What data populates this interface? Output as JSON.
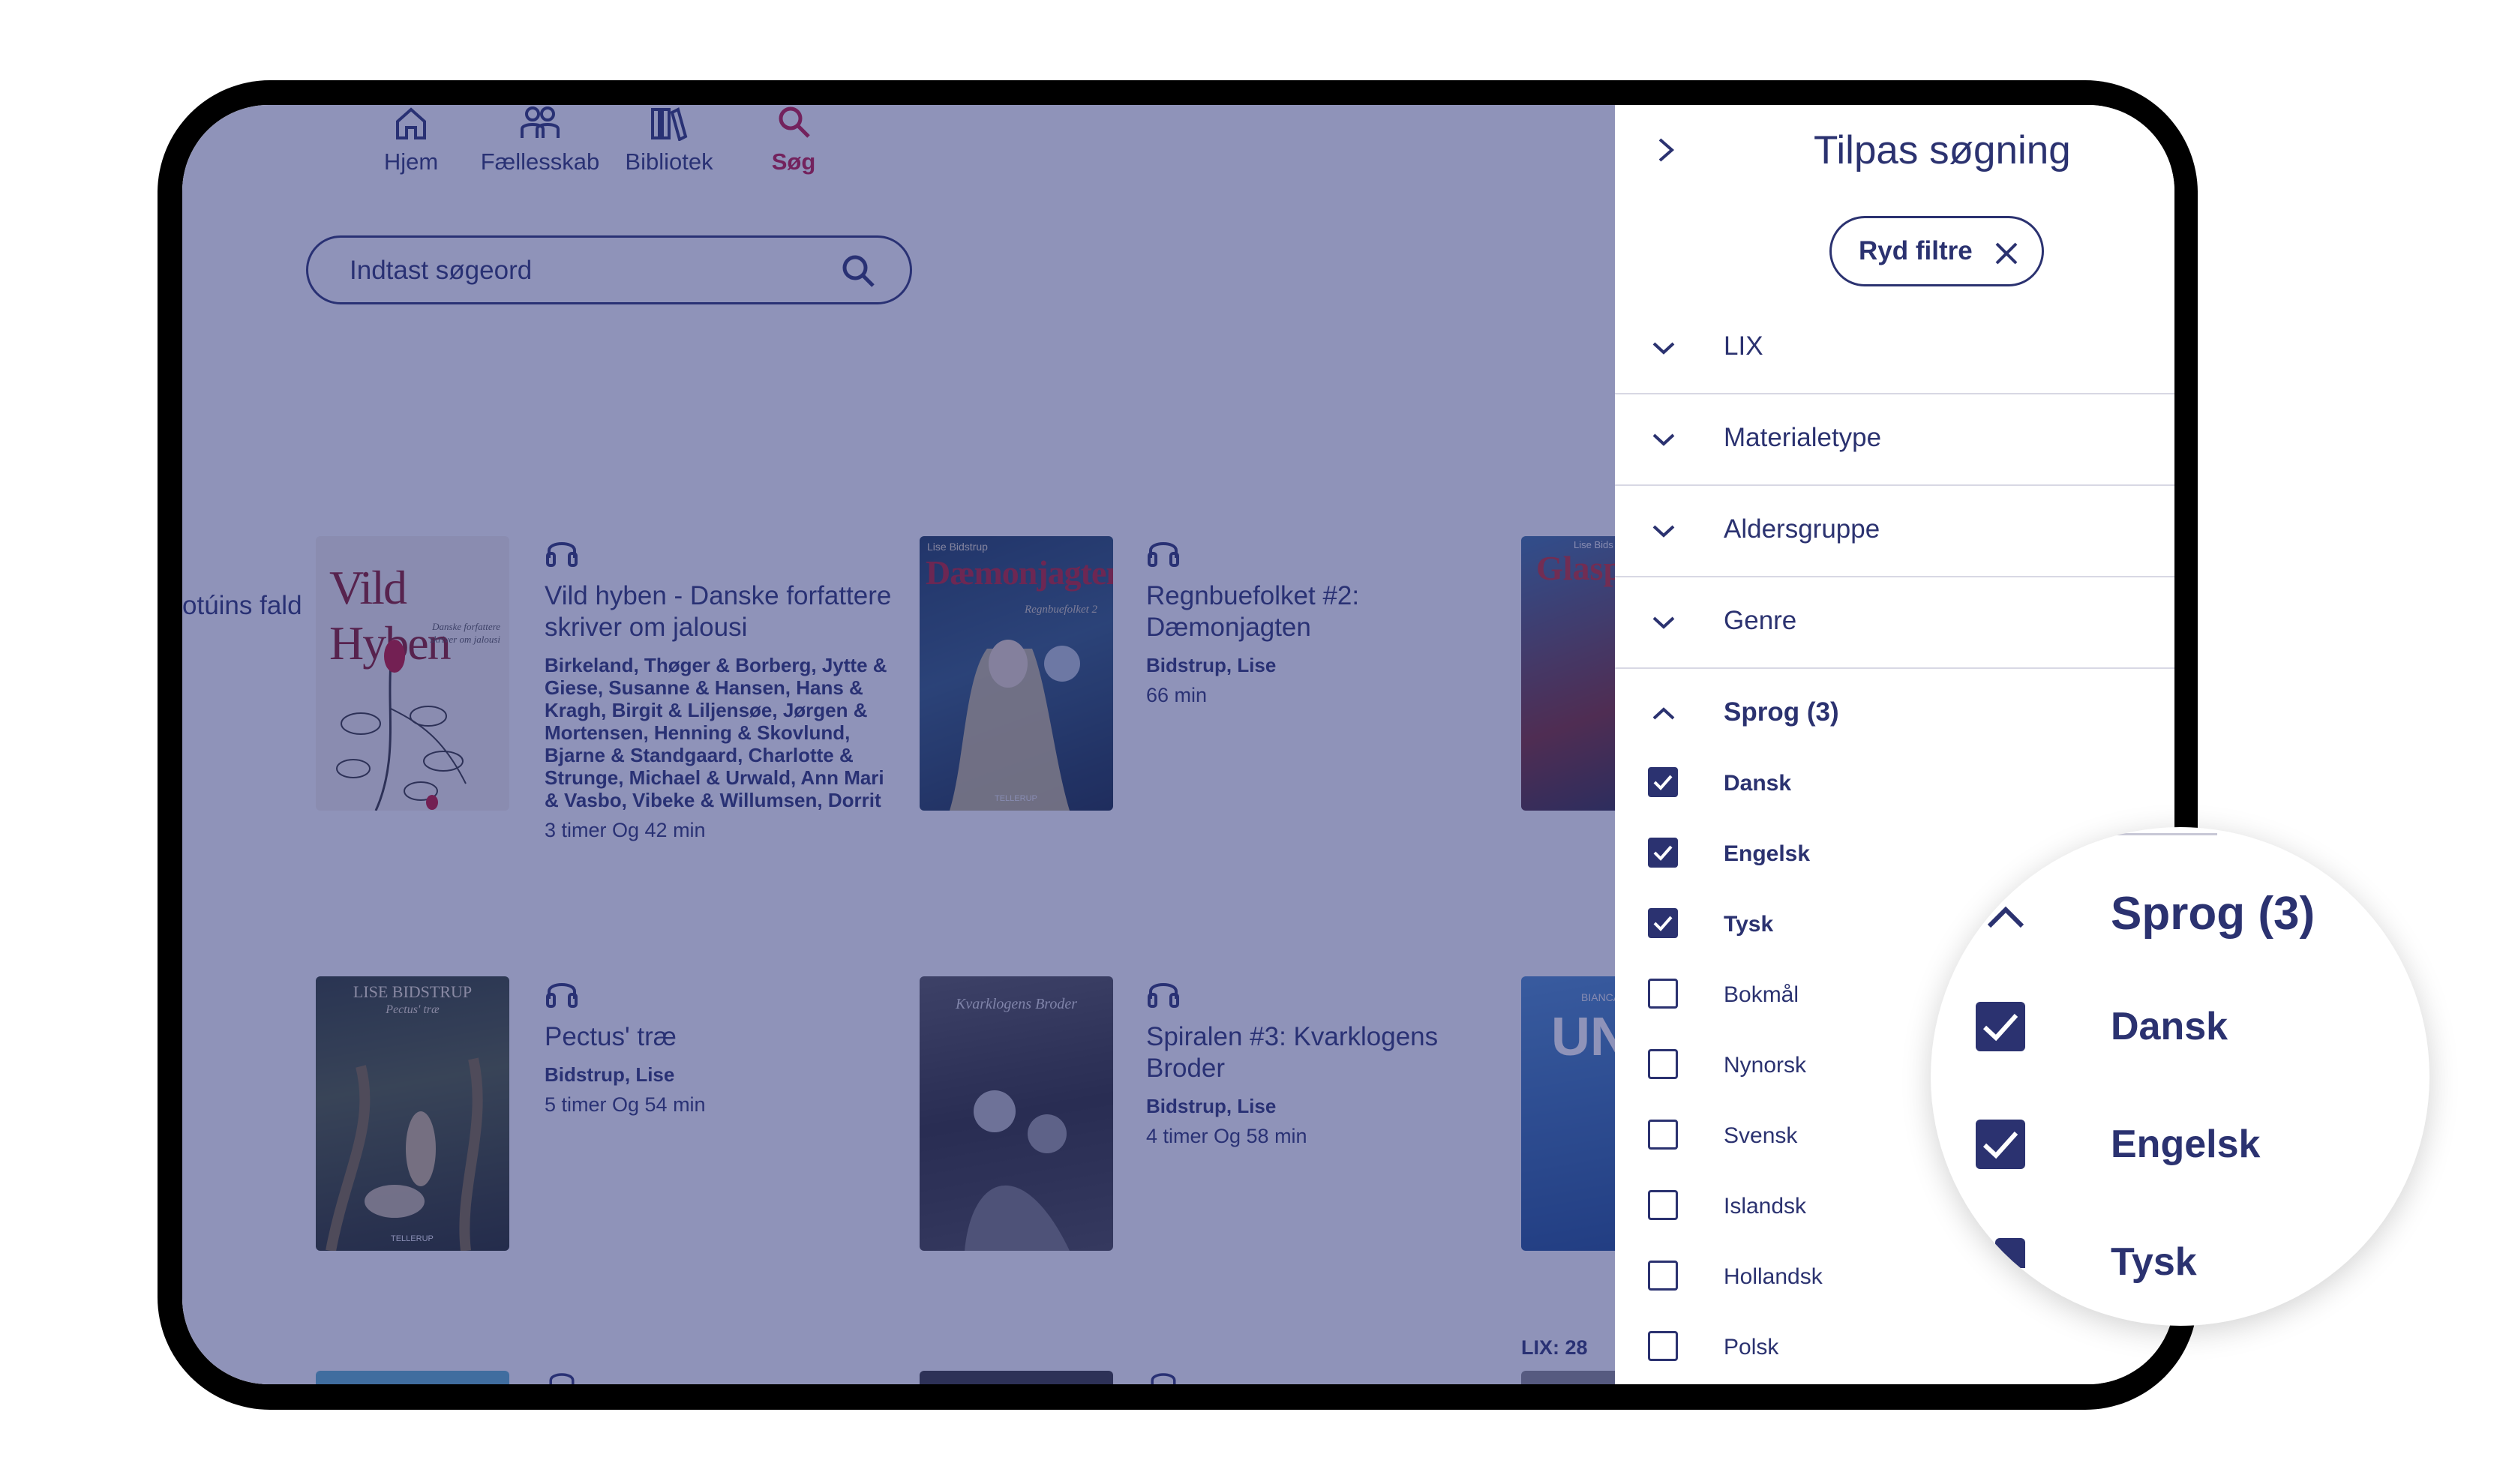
{
  "nav": {
    "items": [
      {
        "label": "Hjem",
        "icon": "home-icon"
      },
      {
        "label": "Fællesskab",
        "icon": "community-icon"
      },
      {
        "label": "Bibliotek",
        "icon": "library-icon"
      },
      {
        "label": "Søg",
        "icon": "search-icon",
        "active": true
      }
    ]
  },
  "search": {
    "placeholder": "Indtast søgeord"
  },
  "partial_title": "otúins fald",
  "books": [
    {
      "title": "Vild hyben - Danske forfattere skriver om jalousi",
      "authors": "Birkeland, Thøger & Borberg, Jytte & Giese, Susanne & Hansen, Hans & Kragh, Birgit & Liljensøe, Jørgen & Mortensen, Henning & Skovlund, Bjarne & Standgaard, Charlotte & Strunge, Michael & Urwald, Ann Mari & Vasbo, Vibeke & Willumsen, Dorrit",
      "duration": "3 timer Og 42 min",
      "cover_text": "Vild Hyben",
      "cover_sub": "Danske forfattere skriver om jalousi"
    },
    {
      "title": "Regnbuefolket #2: Dæmonjagten",
      "authors": "Bidstrup, Lise",
      "duration": "66 min",
      "cover_text": "Dæmonjagten",
      "cover_sub": "Lise Bidstrup",
      "cover_sub2": "Regnbuefolket 2",
      "publisher": "TELLERUP"
    },
    {
      "title": "Pectus' træ",
      "authors": "Bidstrup, Lise",
      "duration": "5 timer Og 54 min",
      "cover_text": "LISE BIDSTRUP",
      "cover_sub": "Pectus' træ",
      "publisher": "TELLERUP"
    },
    {
      "title": "Spiralen #3: Kvarklogens Broder",
      "authors": "Bidstrup, Lise",
      "duration": "4 timer Og 58 min",
      "cover_text": "Kvarklogens Broder"
    }
  ],
  "partial_covers": {
    "top": "Glasp",
    "top_sub": "Lise Bids",
    "mid": "UN",
    "mid_sub": "BIANCA"
  },
  "lix_label": "LIX: 28",
  "panel": {
    "title": "Tilpas søgning",
    "clear_label": "Ryd filtre",
    "sections": [
      "LIX",
      "Materialetype",
      "Aldersgruppe",
      "Genre"
    ],
    "open_section": "Sprog (3)",
    "languages": [
      {
        "label": "Dansk",
        "checked": true
      },
      {
        "label": "Engelsk",
        "checked": true
      },
      {
        "label": "Tysk",
        "checked": true
      },
      {
        "label": "Bokmål",
        "checked": false
      },
      {
        "label": "Nynorsk",
        "checked": false
      },
      {
        "label": "Svensk",
        "checked": false
      },
      {
        "label": "Islandsk",
        "checked": false
      },
      {
        "label": "Hollandsk",
        "checked": false
      },
      {
        "label": "Polsk",
        "checked": false
      }
    ]
  },
  "zoom": {
    "title": "Sprog (3)",
    "items": [
      "Dansk",
      "Engelsk",
      "Tysk"
    ]
  },
  "colors": {
    "primary": "#2b3270",
    "accent": "#c4143f",
    "overlay": "rgba(40,48,120,0.52)"
  }
}
